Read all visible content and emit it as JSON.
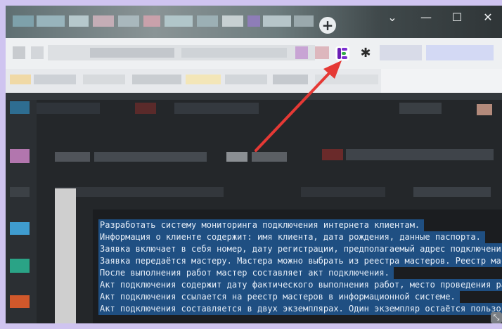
{
  "browser": {
    "new_tab_label": "+",
    "window_controls": {
      "menu": "⌄",
      "minimize": "—",
      "maximize": "☐",
      "close": "✕"
    },
    "extensions": {
      "highlighted_extension_icon": "app-logo-icon",
      "extensions_menu_icon": "puzzle-icon"
    }
  },
  "annotation": {
    "arrow_color": "#e53935"
  },
  "editor": {
    "selection_color": "#1f4f82",
    "lines": [
      "Разработать систему мониторинга подключения интернета клиентам.",
      "Информация о клиенте содержит: имя клиента, дата рождения, данные паспорта.",
      "Заявка включает в себя номер, дату регистрации, предполагаемый адрес подключения. Заяв",
      "Заявка передаётся мастеру. Мастера можно выбрать из реестра мастеров. Реестр мастеров",
      "После выполнения работ мастер составляет акт подключения.",
      "Акт подключения содержит дату фактического выполнения работ, место проведения работ, о",
      "Акт подключения ссылается на реестр мастеров в информационной системе.",
      "Акт подключения составляется в двух экземплярах. Один экземпляр остаётся пользователю,"
    ]
  }
}
